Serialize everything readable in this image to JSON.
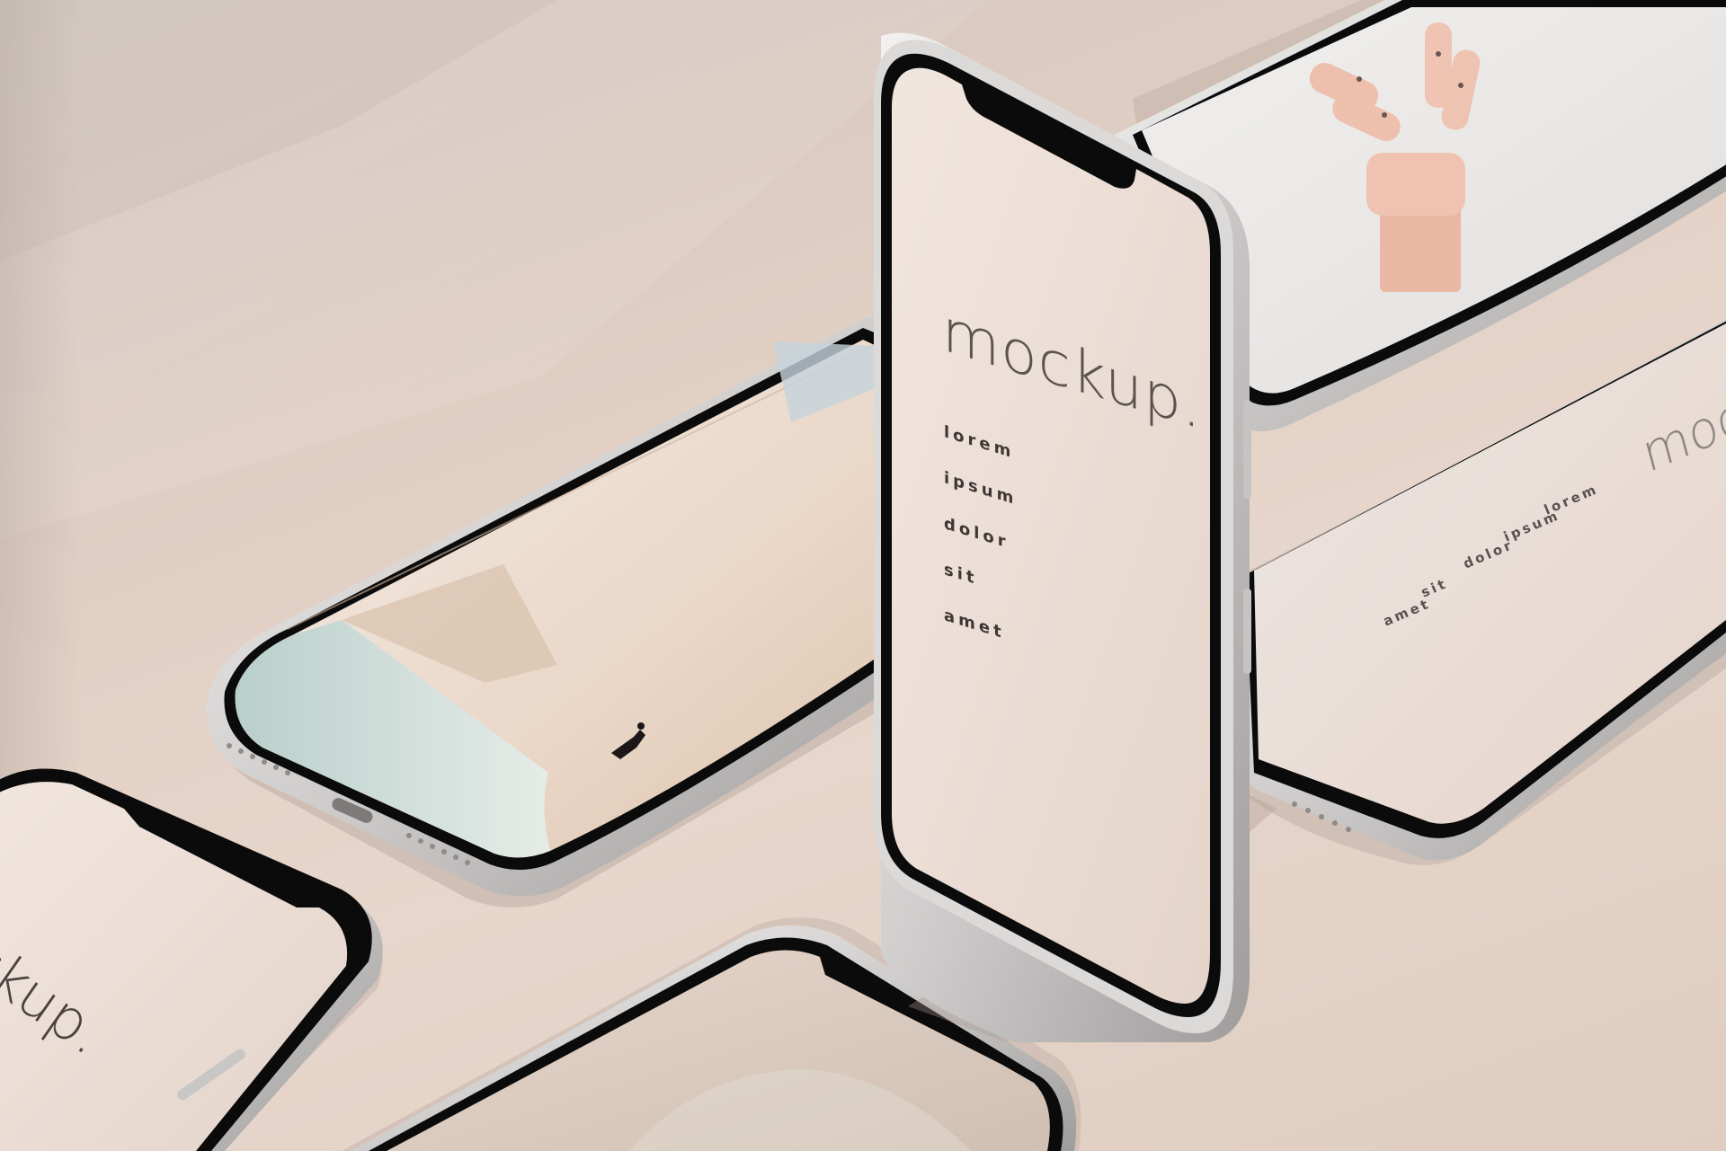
{
  "scene": {
    "background_color": "#e3d2c7",
    "shadow_color": "#b9aba4",
    "frame_color": "#d5d3d2",
    "bezel_color": "#0b0b0b",
    "screen_color": "#ede1da"
  },
  "center_phone": {
    "title": "mockup.",
    "menu": [
      "lorem",
      "ipsum",
      "dolor",
      "sit",
      "amet"
    ]
  },
  "right_phone": {
    "title": "mock",
    "menu": [
      "lorem",
      "ipsum",
      "dolor",
      "sit",
      "amet"
    ]
  },
  "left_bottom_phone": {
    "title": "ckup."
  },
  "photo_phone": {
    "content": "beach-photo"
  },
  "hand_phone": {
    "content": "wooden-hand-photo"
  }
}
